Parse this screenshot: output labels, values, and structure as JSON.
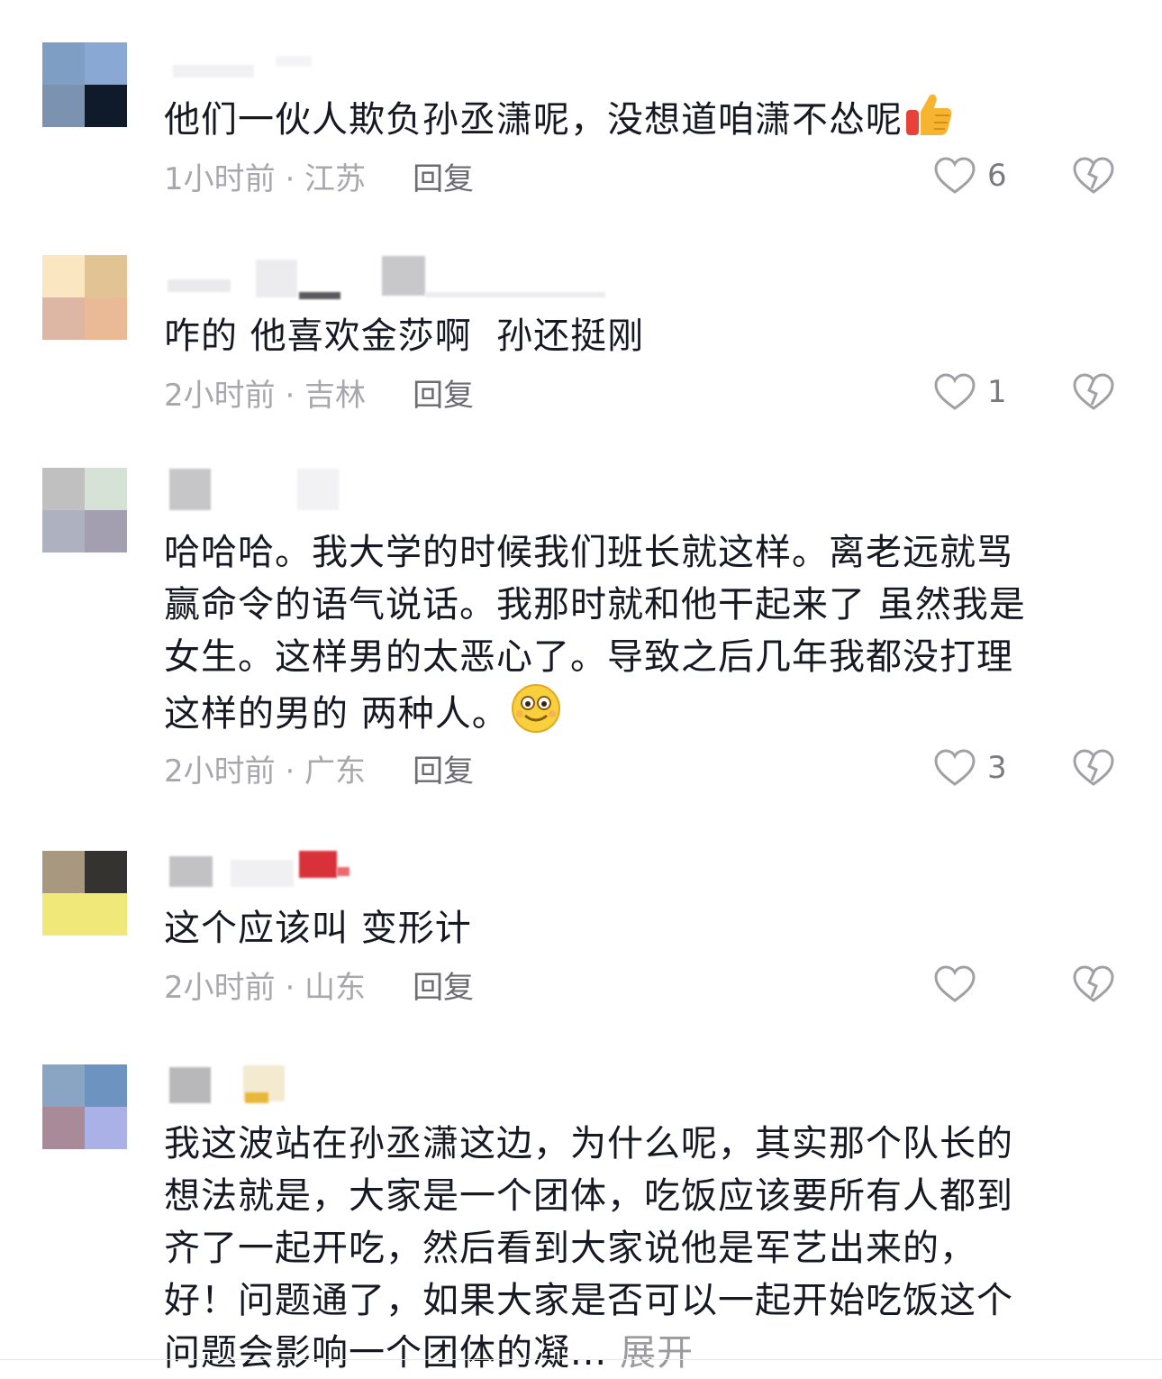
{
  "comments": [
    {
      "text": "他们一伙人欺负孙丞潇呢，没想道咱潇不怂呢",
      "emoji": "thumbs-up-emoji",
      "time_location": "1小时前 · 江苏",
      "reply_label": "回复",
      "like_count": "6",
      "avatar_colors": [
        "#7f9ec3",
        "#8aa8d4",
        "#7b93b0",
        "#0f1a2b"
      ]
    },
    {
      "text": "咋的 他喜欢金莎啊  孙还挺刚",
      "time_location": "2小时前 · 吉林",
      "reply_label": "回复",
      "like_count": "1",
      "avatar_colors": [
        "#fbe6c2",
        "#e1c394",
        "#ddb7a4",
        "#eab995"
      ]
    },
    {
      "text": "哈哈哈。我大学的时候我们班长就这样。离老远就骂\n赢命令的语气说话。我那时就和他干起来了 虽然我是\n女生。这样男的太恶心了。导致之后几年我都没打理\n这样的男的 两种人。",
      "emoji": "smiling-face-emoji",
      "time_location": "2小时前 · 广东",
      "reply_label": "回复",
      "like_count": "3",
      "avatar_colors": [
        "#c0c0c0",
        "#d6e2d6",
        "#aeb1c0",
        "#a39eb0"
      ]
    },
    {
      "text": "这个应该叫 变形计",
      "time_location": "2小时前 · 山东",
      "reply_label": "回复",
      "like_count": "",
      "avatar_colors": [
        "#a89880",
        "#34332f",
        "#f1e87a",
        "#f1e87a"
      ]
    },
    {
      "text": "我这波站在孙丞潇这边，为什么呢，其实那个队长的\n想法就是，大家是一个团体，吃饭应该要所有人都到\n齐了一起开吃，然后看到大家说他是军艺出来的，\n好！问题通了，如果大家是否可以一起开始吃饭这个\n问题会影响一个团体的凝...",
      "expand_label": "展开",
      "avatar_colors": [
        "#8aa5c4",
        "#6d93c0",
        "#a88a98",
        "#a9b1e6"
      ]
    }
  ]
}
